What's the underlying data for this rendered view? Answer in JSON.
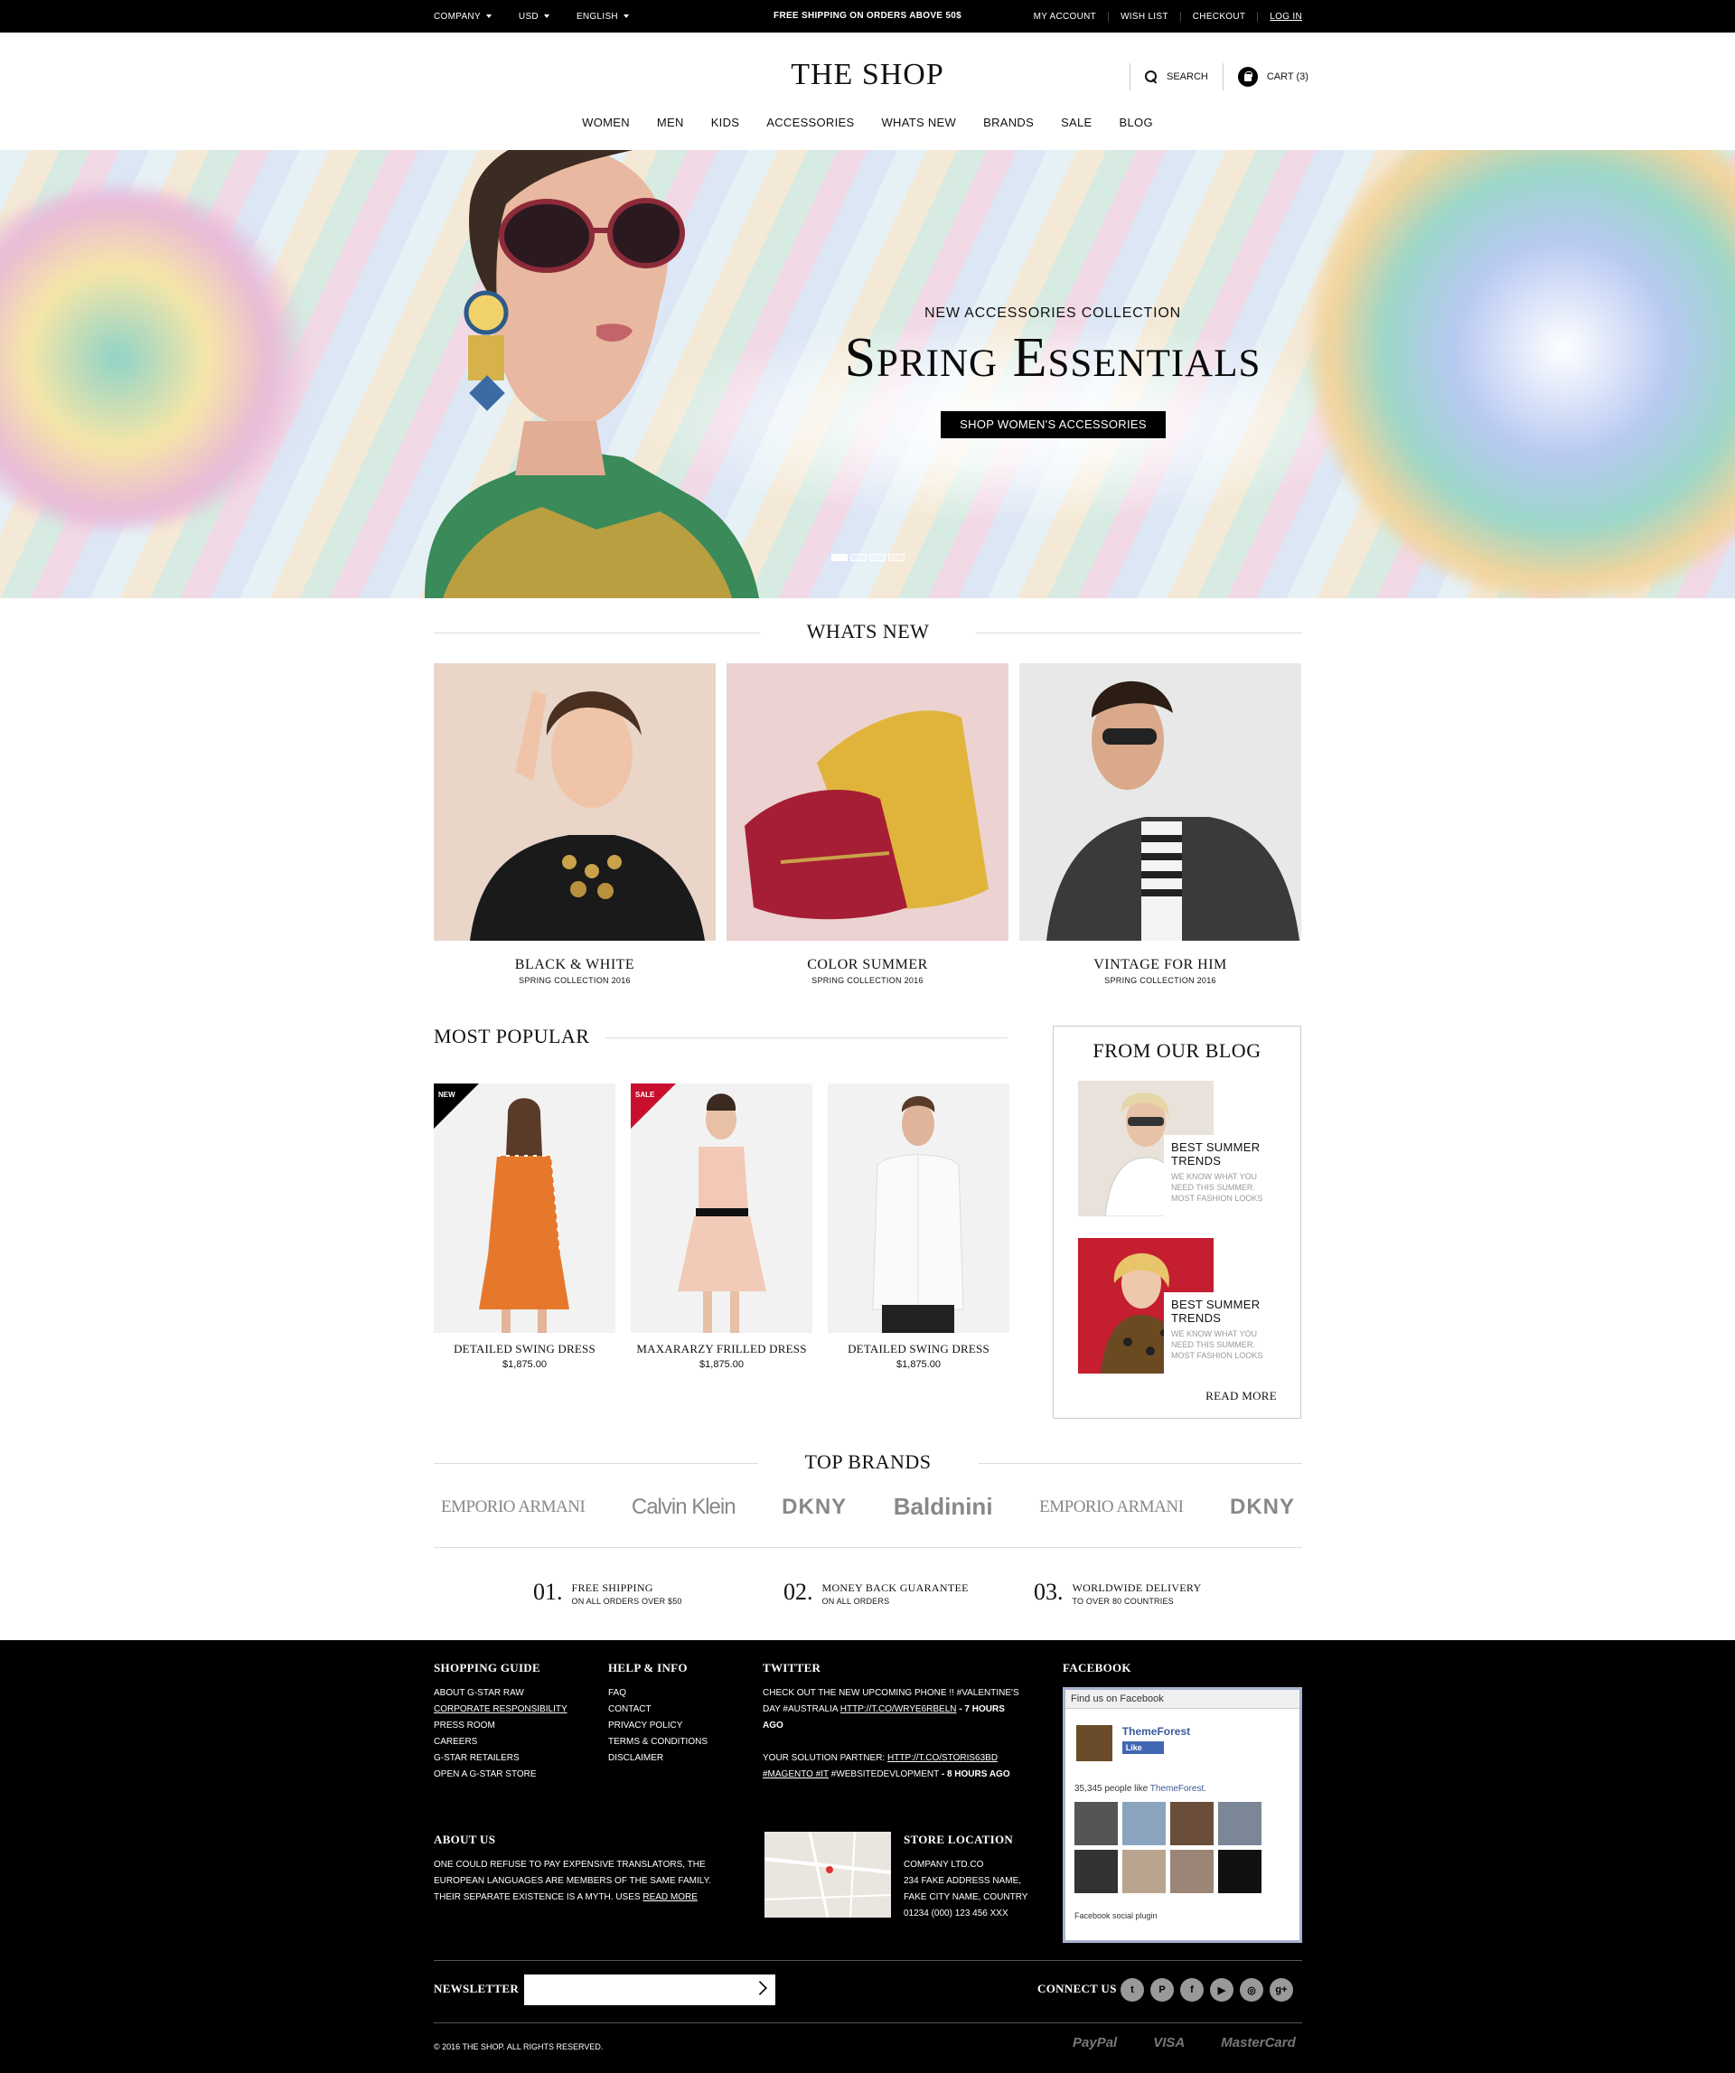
{
  "topbar": {
    "company": "COMPANY",
    "currency": "USD",
    "language": "ENGLISH",
    "promo": "FREE SHIPPING ON ORDERS ABOVE 50$",
    "my_account": "MY ACCOUNT",
    "wish_list": "WISH LIST",
    "checkout": "CHECKOUT",
    "login": "LOG IN"
  },
  "header": {
    "logo": "THE SHOP",
    "search": "SEARCH",
    "cart": "CART (3)"
  },
  "nav": [
    "WOMEN",
    "MEN",
    "KIDS",
    "ACCESSORIES",
    "WHATS NEW",
    "BRANDS",
    "SALE",
    "BLOG"
  ],
  "hero": {
    "subtitle": "NEW ACCESSORIES COLLECTION",
    "title": "Spring Essentials",
    "cta": "SHOP WOMEN'S ACCESSORIES",
    "slides": 4,
    "active_slide": 1
  },
  "whats_new": {
    "heading": "WHATS NEW",
    "items": [
      {
        "title": "BLACK & WHITE",
        "subtitle": "SPRING COLLECTION 2016"
      },
      {
        "title": "COLOR SUMMER",
        "subtitle": "SPRING COLLECTION 2016"
      },
      {
        "title": "VINTAGE FOR HIM",
        "subtitle": "SPRING COLLECTION 2016"
      }
    ]
  },
  "most_popular": {
    "heading": "MOST POPULAR",
    "products": [
      {
        "badge": "NEW",
        "name": "DETAILED SWING DRESS",
        "price": "$1,875.00"
      },
      {
        "badge": "SALE",
        "name": "MAXARARZY FRILLED DRESS",
        "price": "$1,875.00"
      },
      {
        "badge": "",
        "name": "DETAILED SWING DRESS",
        "price": "$1,875.00"
      }
    ]
  },
  "blog": {
    "heading": "FROM OUR BLOG",
    "posts": [
      {
        "title": "BEST SUMMER TRENDS",
        "excerpt": "WE KNOW WHAT YOU NEED THIS SUMMER. MOST FASHION LOOKS"
      },
      {
        "title": "BEST SUMMER TRENDS",
        "excerpt": "WE KNOW WHAT YOU NEED THIS SUMMER. MOST FASHION LOOKS"
      }
    ],
    "read_more": "READ MORE"
  },
  "brands": {
    "heading": "TOP BRANDS",
    "logos": [
      "EMPORIO ARMANI",
      "Calvin Klein",
      "DKNY",
      "Baldinini",
      "EMPORIO ARMANI",
      "DKNY"
    ]
  },
  "features": [
    {
      "num": "01.",
      "title": "FREE SHIPPING",
      "sub": "ON ALL ORDERS OVER $50"
    },
    {
      "num": "02.",
      "title": "MONEY BACK GUARANTEE",
      "sub": "ON ALL ORDERS"
    },
    {
      "num": "03.",
      "title": "WORLDWIDE DELIVERY",
      "sub": "TO OVER 80 COUNTRIES"
    }
  ],
  "footer": {
    "shopping_guide": {
      "heading": "SHOPPING GUIDE",
      "links": [
        "ABOUT G-STAR RAW",
        "CORPORATE RESPONSIBILITY",
        "PRESS ROOM",
        "CAREERS",
        "G-STAR RETAILERS",
        "OPEN A G-STAR STORE"
      ]
    },
    "help": {
      "heading": "HELP & INFO",
      "links": [
        "FAQ",
        "CONTACT",
        "PRIVACY POLICY",
        "TERMS & CONDITIONS",
        "DISCLAIMER"
      ]
    },
    "twitter": {
      "heading": "TWITTER",
      "t1_text": "CHECK OUT THE NEW UPCOMING PHONE !! #VALENTINE'S DAY #AUSTRALIA",
      "t1_link": "HTTP://T.CO/WRYE6RBELN",
      "t1_time": "- 7 HOURS AGO",
      "t2_text": "YOUR SOLUTION PARTNER:",
      "t2_link": "HTTP://T.CO/STORIS63BD",
      "t2_tags_link": "#MAGENTO #IT",
      "t2_tags": "#WEBSITEDEVLOPMENT",
      "t2_time": "- 8 HOURS AGO"
    },
    "facebook": {
      "heading": "FACEBOOK",
      "find_us": "Find us on Facebook",
      "page_name": "ThemeForest",
      "like": "Like",
      "count_text": "35,345 people like",
      "count_link": "ThemeForest.",
      "plugin": "Facebook social plugin"
    },
    "about": {
      "heading": "ABOUT US",
      "text": "ONE COULD REFUSE TO PAY EXPENSIVE TRANSLATORS, THE EUROPEAN LANGUAGES ARE MEMBERS OF THE SAME FAMILY. THEIR SEPARATE EXISTENCE IS A MYTH. USES",
      "link": "READ MORE"
    },
    "store": {
      "heading": "STORE LOCATION",
      "lines": [
        "COMPANY LTD.CO",
        "234 FAKE ADDRESS NAME,",
        "FAKE CITY NAME, COUNTRY",
        "01234 (000) 123 456 XXX"
      ]
    },
    "newsletter": {
      "label": "NEWSLETTER",
      "placeholder": ""
    },
    "connect": "CONNECT US",
    "copyright": "© 2016 THE SHOP. ALL RIGHTS RESERVED.",
    "payments": [
      "PayPal",
      "VISA",
      "MasterCard"
    ]
  }
}
